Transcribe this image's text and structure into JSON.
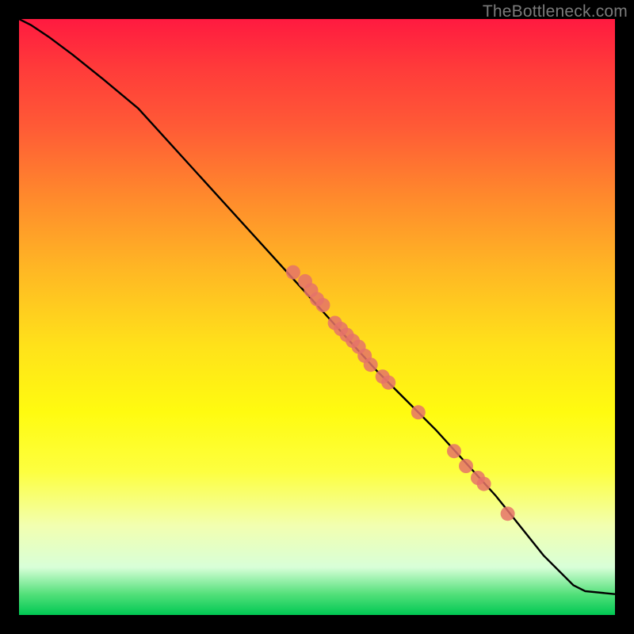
{
  "watermark": "TheBottleneck.com",
  "chart_data": {
    "type": "line",
    "title": "",
    "xlabel": "",
    "ylabel": "",
    "xlim": [
      0,
      100
    ],
    "ylim": [
      0,
      100
    ],
    "grid": false,
    "legend": false,
    "series": [
      {
        "name": "curve",
        "color": "#000000",
        "x": [
          0,
          2,
          5,
          9,
          14,
          20,
          30,
          40,
          50,
          60,
          70,
          80,
          88,
          93,
          95,
          100
        ],
        "y": [
          100,
          99,
          97,
          94,
          90,
          85,
          74,
          63,
          52,
          41,
          31,
          20,
          10,
          5,
          4,
          3.5
        ]
      }
    ],
    "points": {
      "name": "highlighted-points",
      "color": "#e57368",
      "radius": 9,
      "x": [
        46,
        48,
        49,
        50,
        51,
        53,
        54,
        55,
        56,
        57,
        58,
        59,
        61,
        62,
        67,
        73,
        75,
        77,
        78,
        82
      ],
      "y": [
        57.5,
        56,
        54.5,
        53,
        52,
        49,
        48,
        47,
        46,
        45,
        43.5,
        42,
        40,
        39,
        34,
        27.5,
        25,
        23,
        22,
        17
      ]
    }
  }
}
